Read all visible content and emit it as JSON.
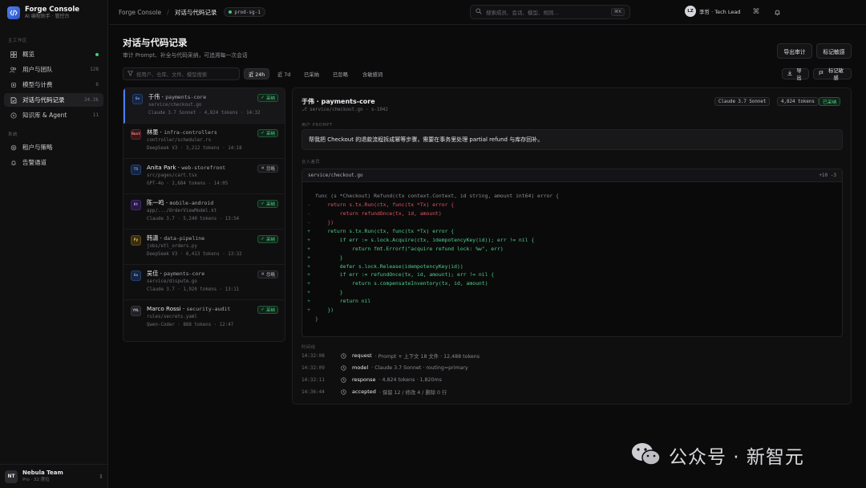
{
  "app": {
    "title": "Forge Console",
    "subtitle": "AI 编程助手 · 管控台"
  },
  "sidebar": {
    "section_main": "主工作区",
    "section_settings": "系统",
    "items": [
      {
        "label": "概览",
        "count": "",
        "icon": "grid-icon",
        "dot": true
      },
      {
        "label": "用户与团队",
        "count": "128",
        "icon": "users-icon"
      },
      {
        "label": "模型与计费",
        "count": "6",
        "icon": "cpu-icon"
      },
      {
        "label": "对话与代码记录",
        "count": "24.3k",
        "icon": "code-log-icon",
        "active": true
      },
      {
        "label": "知识库 & Agent",
        "count": "11",
        "icon": "book-icon"
      },
      {
        "label": "租户与策略",
        "count": "",
        "icon": "policy-icon"
      },
      {
        "label": "告警通道",
        "count": "",
        "icon": "bell-icon"
      }
    ],
    "team": {
      "initials": "NT",
      "name": "Nebula Team",
      "plan": "Pro · 32 席位"
    }
  },
  "topbar": {
    "crumb_root": "Forge Console",
    "crumb_current": "对话与代码记录",
    "env": "prod-sg-1",
    "search_placeholder": "搜索成员、会话、模型、规则…",
    "search_kbd": "⌘K",
    "user_initials": "LZ",
    "user_name": "李哲 · Tech Lead"
  },
  "page": {
    "title": "对话与代码记录",
    "subtitle": "审计 Prompt、补全与代码采纳，可追溯每一次会话",
    "export_audit": "导出审计",
    "mark_sensitive": "标记敏感"
  },
  "filters": {
    "placeholder": "按用户、仓库、文件、模型搜索",
    "chips": [
      "近 24h",
      "近 7d",
      "已采纳",
      "已忽略",
      "含敏感词"
    ],
    "active_chip": 0
  },
  "sessions": [
    {
      "icon": "Go",
      "icon_color": "#4f7ef0",
      "user": "于伟",
      "repo": "payments-core",
      "path": "service/checkout.go",
      "meta": "Claude 3.7 Sonnet · 4,824 tokens · 14:32",
      "status": "采纳",
      "accepted": true,
      "active": true
    },
    {
      "icon": "Rust",
      "icon_color": "#e0565f",
      "user": "林墨",
      "repo": "infra-controllers",
      "path": "controller/scheduler.rs",
      "meta": "DeepSeek V3 · 3,212 tokens · 14:18",
      "status": "采纳",
      "accepted": true
    },
    {
      "icon": "TS",
      "icon_color": "#4f7ef0",
      "user": "Anita Park",
      "repo": "web-storefront",
      "path": "src/pages/cart.tsx",
      "meta": "GPT-4o · 2,684 tokens · 14:05",
      "status": "忽略",
      "accepted": false
    },
    {
      "icon": "Kt",
      "icon_color": "#a57ef0",
      "user": "陈一鸣",
      "repo": "mobile-android",
      "path": "app/.../OrderViewModel.kt",
      "meta": "Claude 3.7 · 5,240 tokens · 13:54",
      "status": "采纳",
      "accepted": true
    },
    {
      "icon": "Py",
      "icon_color": "#e0b84f",
      "user": "韩潇",
      "repo": "data-pipeline",
      "path": "jobs/etl_orders.py",
      "meta": "DeepSeek V3 · 6,413 tokens · 13:32",
      "status": "采纳",
      "accepted": true
    },
    {
      "icon": "Go",
      "icon_color": "#4f7ef0",
      "user": "吴佳",
      "repo": "payments-core",
      "path": "service/dispute.go",
      "meta": "Claude 3.7 · 1,920 tokens · 13:11",
      "status": "忽略",
      "accepted": false
    },
    {
      "icon": "YML",
      "icon_color": "#9a9aa0",
      "user": "Marco Rossi",
      "repo": "security-audit",
      "path": "rules/secrets.yaml",
      "meta": "Qwen-Coder · 868 tokens · 12:47",
      "status": "采纳",
      "accepted": true
    }
  ],
  "detail": {
    "title": "于伟 · payments-core",
    "meta": "⎇ service/checkout.go  ·  s-1042",
    "model_tag": "Claude 3.7 Sonnet",
    "tokens_tag": "4,824 tokens",
    "status_tag": "已采纳",
    "export": "导出",
    "mark_sensitive": "标记敏感",
    "prompt_label": "用户 PROMPT",
    "prompt": "帮我把 Checkout 的退款流程拆成幂等步骤，需要在事务里处理 partial refund 与库存回补。",
    "diff_label": "合入差异",
    "diff_file": "service/checkout.go",
    "diff_stat": "+10 -3",
    "code": [
      {
        "t": "ctx",
        "text": "func (s *Checkout) Refund(ctx context.Context, id string, amount int64) error {"
      },
      {
        "t": "del",
        "text": "    return s.tx.Run(ctx, func(tx *Tx) error {"
      },
      {
        "t": "del",
        "text": "        return refundOnce(tx, id, amount)"
      },
      {
        "t": "del",
        "text": "    })"
      },
      {
        "t": "add",
        "text": "    return s.tx.Run(ctx, func(tx *Tx) error {"
      },
      {
        "t": "add",
        "text": "        if err := s.lock.Acquire(ctx, idempotencyKey(id)); err != nil {"
      },
      {
        "t": "add",
        "text": "            return fmt.Errorf(\"acquire refund lock: %w\", err)"
      },
      {
        "t": "add",
        "text": "        }"
      },
      {
        "t": "add",
        "text": "        defer s.lock.Release(idempotencyKey(id))"
      },
      {
        "t": "add",
        "text": "        if err := refundOnce(tx, id, amount); err != nil {"
      },
      {
        "t": "add",
        "text": "            return s.compensateInventory(tx, id, amount)"
      },
      {
        "t": "add",
        "text": "        }"
      },
      {
        "t": "add",
        "text": "        return nil"
      },
      {
        "t": "add",
        "text": "    })"
      },
      {
        "t": "ctx",
        "text": "}"
      }
    ],
    "timeline_label": "时间线",
    "timeline": [
      {
        "time": "14:32:08",
        "event": "request",
        "desc": "· Prompt + 上下文 18 文件 · 12,488 tokens"
      },
      {
        "time": "14:32:09",
        "event": "model",
        "desc": "· Claude 3.7 Sonnet · routing=primary"
      },
      {
        "time": "14:32:11",
        "event": "response",
        "desc": "· 4,824 tokens · 1,820ms"
      },
      {
        "time": "14:36:44",
        "event": "accepted",
        "desc": "· 保留 12 / 修改 4 / 删除 0 行"
      }
    ]
  },
  "watermark": {
    "text": "公众号 · 新智元"
  }
}
